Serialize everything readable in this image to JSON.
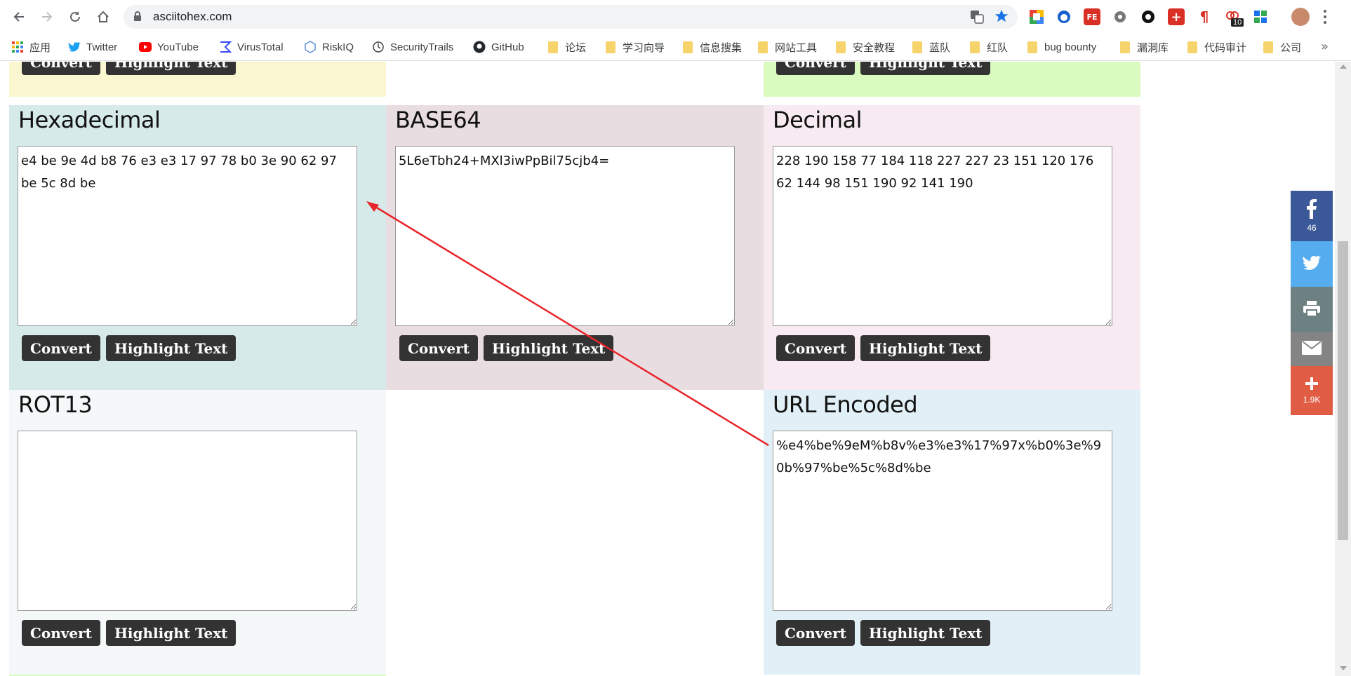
{
  "browser": {
    "url": "asciitohex.com",
    "extension_badge": "10"
  },
  "bookmarks": [
    {
      "label": "应用",
      "icon": "apps-grid-icon"
    },
    {
      "label": "Twitter",
      "icon": "twitter-bird-icon"
    },
    {
      "label": "YouTube",
      "icon": "youtube-play-icon"
    },
    {
      "label": "VirusTotal",
      "icon": "virustotal-icon"
    },
    {
      "label": "RiskIQ",
      "icon": "riskiq-icon"
    },
    {
      "label": "SecurityTrails",
      "icon": "securitytrails-icon"
    },
    {
      "label": "GitHub",
      "icon": "github-icon"
    },
    {
      "label": "论坛",
      "icon": "folder-icon"
    },
    {
      "label": "学习向导",
      "icon": "folder-icon"
    },
    {
      "label": "信息搜集",
      "icon": "folder-icon"
    },
    {
      "label": "网站工具",
      "icon": "folder-icon"
    },
    {
      "label": "安全教程",
      "icon": "folder-icon"
    },
    {
      "label": "蓝队",
      "icon": "folder-icon"
    },
    {
      "label": "红队",
      "icon": "folder-icon"
    },
    {
      "label": "bug bounty",
      "icon": "folder-icon"
    },
    {
      "label": "漏洞库",
      "icon": "folder-icon"
    },
    {
      "label": "代码审计",
      "icon": "folder-icon"
    },
    {
      "label": "公司",
      "icon": "folder-icon"
    }
  ],
  "buttons": {
    "convert": "Convert",
    "highlight": "Highlight Text"
  },
  "panels": {
    "hex": {
      "title": "Hexadecimal",
      "value": "e4 be 9e 4d b8 76 e3 e3 17 97 78 b0 3e 90 62 97 be 5c 8d be",
      "bg": "#d6eae9"
    },
    "base64": {
      "title": "BASE64",
      "value": "5L6eTbh24+MXl3iwPpBil75cjb4=",
      "bg": "#e8dde1"
    },
    "decimal": {
      "title": "Decimal",
      "value": "228 190 158 77 184 118 227 227 23 151 120 176 62 144 98 151 190 92 141 190",
      "bg": "#f8eaf1"
    },
    "rot13": {
      "title": "ROT13",
      "value": "",
      "bg": "#f4f8f8"
    },
    "url": {
      "title": "URL Encoded",
      "value": "%e4%be%9eM%b8v%e3%e3%17%97x%b0%3e%90b%97%be%5c%8d%be",
      "bg": "#e1eff6"
    },
    "top_left_bg": "#faf7d0",
    "top_right_bg": "#d9fbbf"
  },
  "share": [
    {
      "name": "facebook",
      "icon": "facebook-icon",
      "count": "46",
      "color": "#3b5998"
    },
    {
      "name": "twitter",
      "icon": "twitter-icon",
      "count": "",
      "color": "#55acee"
    },
    {
      "name": "print",
      "icon": "print-icon",
      "count": "",
      "color": "#6d8183"
    },
    {
      "name": "email",
      "icon": "email-icon",
      "count": "",
      "color": "#848484"
    },
    {
      "name": "more",
      "icon": "plus-icon",
      "count": "1.9K",
      "color": "#e05d44"
    }
  ],
  "annotation": {
    "color": "#e8252b"
  }
}
